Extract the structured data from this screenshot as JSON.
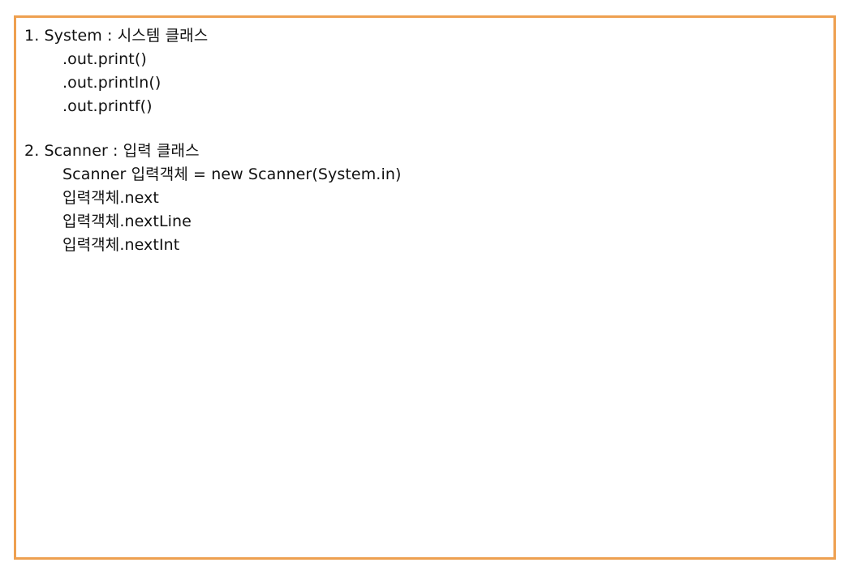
{
  "sections": [
    {
      "heading": "1. System : 시스템 클래스",
      "lines": [
        ".out.print()",
        ".out.println()",
        ".out.printf()"
      ]
    },
    {
      "heading": "2. Scanner : 입력 클래스",
      "lines": [
        "Scanner 입력객체 = new Scanner(System.in)",
        "입력객체.next",
        "입력객체.nextLine",
        "입력객체.nextInt"
      ]
    }
  ],
  "colors": {
    "border": "#eea050",
    "text": "#111111",
    "background": "#ffffff"
  }
}
